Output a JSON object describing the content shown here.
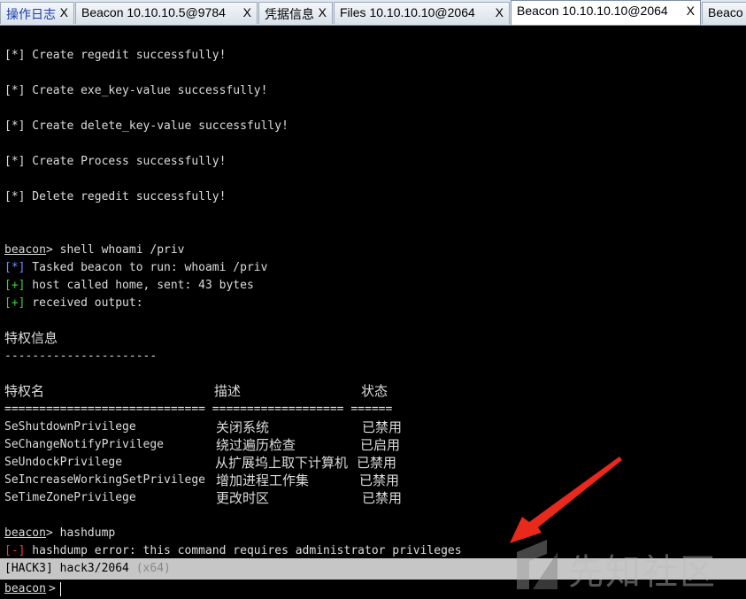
{
  "tabs": [
    {
      "label": "操作日志",
      "close": "X",
      "active": false
    },
    {
      "label": "Beacon 10.10.10.5@9784",
      "close": "X",
      "active": false
    },
    {
      "label": "凭据信息",
      "close": "X",
      "active": false
    },
    {
      "label": "Files 10.10.10.10@2064",
      "close": "X",
      "active": false
    },
    {
      "label": "Beacon 10.10.10.10@2064",
      "close": "X",
      "active": true
    },
    {
      "label": "Beaco",
      "close": "",
      "active": false
    }
  ],
  "console": {
    "results": [
      {
        "tag": "[*]",
        "text": " Create regedit successfully!"
      },
      {
        "tag": "[*]",
        "text": " Create exe_key-value successfully!"
      },
      {
        "tag": "[*]",
        "text": " Create delete_key-value successfully!"
      },
      {
        "tag": "[*]",
        "text": " Create Process successfully!"
      },
      {
        "tag": "[*]",
        "text": " Delete regedit successfully!"
      }
    ],
    "cmd1_prompt": "beacon",
    "cmd1_text": "> shell whoami /priv",
    "task_tag": "[*]",
    "task_text": " Tasked beacon to run: whoami /priv",
    "host_tag": "[+]",
    "host_text": " host called home, sent: 43 bytes",
    "recv_tag": "[+]",
    "recv_text": " received output:",
    "priv_title": "特权信息",
    "priv_title_rule": "----------------------",
    "col_name": "特权名",
    "col_desc": "描述",
    "col_state": "状态",
    "sep_line": "============================= =================== ======",
    "privileges": [
      {
        "name": "SeShutdownPrivilege",
        "desc": "关闭系统",
        "state": "已禁用"
      },
      {
        "name": "SeChangeNotifyPrivilege",
        "desc": "绕过遍历检查",
        "state": "已启用"
      },
      {
        "name": "SeUndockPrivilege",
        "desc": "从扩展坞上取下计算机",
        "state": "已禁用"
      },
      {
        "name": "SeIncreaseWorkingSetPrivilege",
        "desc": "增加进程工作集",
        "state": "已禁用"
      },
      {
        "name": "SeTimeZonePrivilege",
        "desc": "更改时区",
        "state": "已禁用"
      }
    ],
    "cmd2_prompt": "beacon",
    "cmd2_text": "> hashdump",
    "err_tag": "[-]",
    "err_text": " hashdump error: this command requires administrator privileges"
  },
  "status": {
    "session": "[HACK3] hack3/2064 ",
    "arch": "(x64)"
  },
  "input": {
    "prompt": "beacon",
    "gt": ">",
    "value": ""
  },
  "watermark_text": "先知社区",
  "colors": {
    "background": "#000000",
    "info": "#6b8fff",
    "success": "#37d637",
    "error": "#ff3535",
    "statusbar": "#c6c6c6",
    "arrow": "#e8291c"
  }
}
